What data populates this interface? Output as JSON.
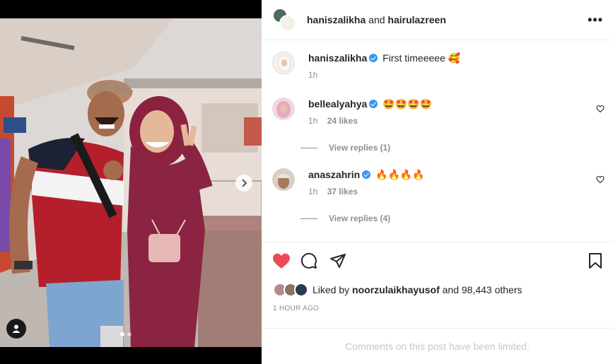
{
  "header": {
    "user1": "haniszalikha",
    "joiner": "and",
    "user2": "hairulazreen",
    "more_label": "•••"
  },
  "caption": {
    "username": "haniszalikha",
    "text": "First timeeeee 🥰",
    "time": "1h"
  },
  "comments": [
    {
      "username": "bellealyahya",
      "text": "🤩🤩🤩🤩",
      "time": "1h",
      "likes": "24 likes",
      "replies": "View replies (1)"
    },
    {
      "username": "anaszahrin",
      "text": "🔥🔥🔥🔥",
      "time": "1h",
      "likes": "37 likes",
      "replies": "View replies (4)"
    }
  ],
  "likes": {
    "prefix": "Liked by",
    "user": "noorzulaikhayusof",
    "suffix": "and 98,443 others"
  },
  "timestamp": "1 HOUR AGO",
  "limited_text": "Comments on this post have been limited.",
  "icons": {
    "like": "heart-filled-icon",
    "comment": "comment-icon",
    "share": "paper-plane-icon",
    "save": "bookmark-icon",
    "next": "chevron-right-icon",
    "tag": "user-tag-icon"
  },
  "colors": {
    "like_red": "#ed4956",
    "verified_blue": "#3897f0",
    "muted": "#8e8e8e"
  },
  "carousel": {
    "slides": 2,
    "active": 1
  }
}
